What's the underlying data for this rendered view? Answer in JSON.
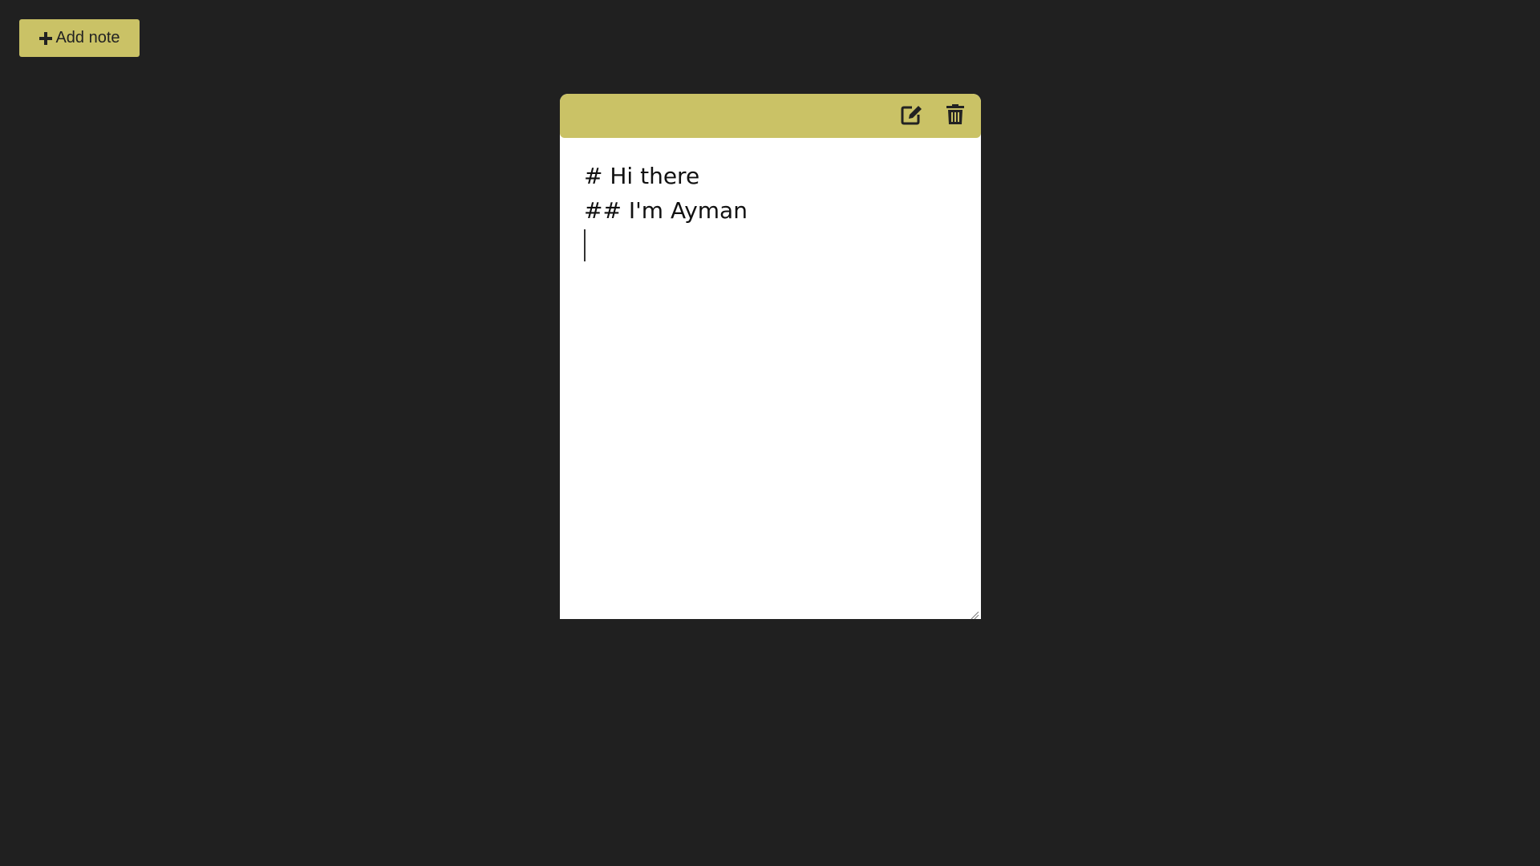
{
  "toolbar": {
    "add_note_label": "Add note",
    "add_note_icon": "plus-icon",
    "accent_color": "#cac266"
  },
  "note": {
    "lines": [
      "# Hi there",
      "## I'm Ayman"
    ],
    "edit_icon": "edit-icon",
    "delete_icon": "trash-icon",
    "background": "#ffffff",
    "header_color": "#cac266"
  },
  "page": {
    "background": "#202020"
  }
}
